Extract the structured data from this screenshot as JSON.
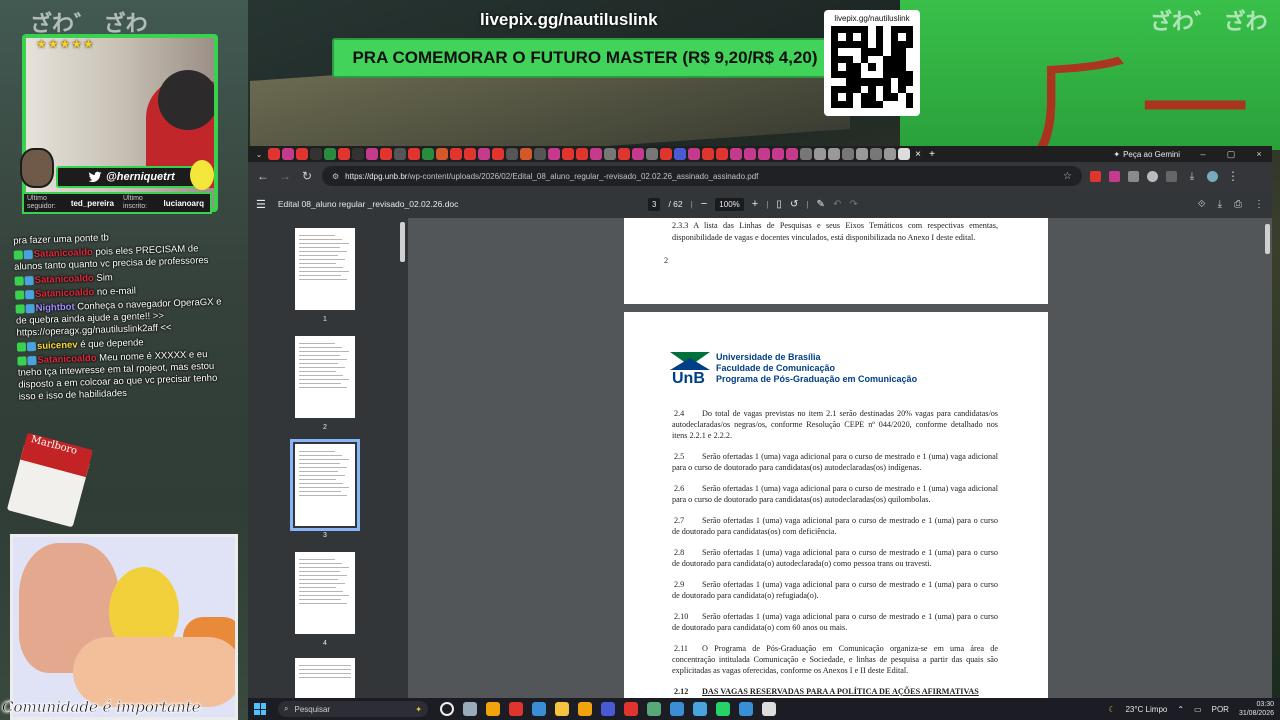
{
  "overlay": {
    "top_url": "livepix.gg/nautiluslink",
    "banner": "PRA COMEMORAR O FUTURO MASTER (R$ 9,20/R$ 4,20)",
    "qr_url": "livepix.gg/nautiluslink",
    "cam_handle": "@herniquetrt",
    "last_follower_label": "Último seguidor:",
    "last_follower": "ted_pereira",
    "last_sub_label": "Último inscrito:",
    "last_sub": "lucianoarq",
    "meme_caption": "Comunidade é importante",
    "marlboro": "Marlboro"
  },
  "chat": [
    {
      "user": "",
      "text": "pra fazer uma ponte tb"
    },
    {
      "user": "Satanicoaldo",
      "text": "pois eles PRECISAM de alunos tanto quanto vc precisa de professores",
      "cls": "u-red"
    },
    {
      "user": "Satanicoaldo",
      "text": "Sim",
      "cls": "u-red"
    },
    {
      "user": "Satanicoaldo",
      "text": "no e-mail",
      "cls": "u-red"
    },
    {
      "user": "Nightbot",
      "text": "Conheça o navegador OperaGX e de quebra ainda ajude a gente!! >> https://operagx.gg/nautiluslink2aff <<",
      "cls": "u-bot"
    },
    {
      "user": "suicenev",
      "text": "é que depende",
      "cls": "u-yel"
    },
    {
      "user": "Satanicoaldo",
      "text": "Meu nome é XXXXX e eu tneho tça intewresse em tal rpojeot, mas estou disposto a em colcoar ao que vc precisar tenho isso e isso de habilidades",
      "cls": "u-red"
    }
  ],
  "browser": {
    "tab_active": "Peça ao Gemini",
    "url_host": "https://dpg.unb.br",
    "url_path": "/wp-content/uploads/2026/02/Edital_08_aluno_regular_-revisado_02.02.26_assinado_assinado.pdf"
  },
  "pdf": {
    "title": "Edital 08_aluno regular _revisado_02.02.26.doc",
    "page_current": "3",
    "page_total": "/ 62",
    "zoom": "100%",
    "thumbs": [
      "1",
      "2",
      "3",
      "4"
    ],
    "page1_text": "2.3.3        A lista das Linhas de Pesquisas e seus Eixos Temáticos com respectivas ementas, disponibilidade de vagas e docentes vinculados, está disponibilizada no Anexo I deste edital.",
    "page1_number": "2",
    "header": {
      "logo": "UnB",
      "line1": "Universidade de Brasília",
      "line2": "Faculdade de Comunicação",
      "line3": "Programa de Pós-Graduação em Comunicação"
    },
    "items": [
      {
        "num": "2.4",
        "text": "Do total de vagas previstas no item 2.1 serão destinadas 20% vagas para candidatas/os autodeclaradas/os negras/os, conforme Resolução CEPE nº 044/2020, conforme detalhado nos itens 2.2.1 e 2.2.2."
      },
      {
        "num": "2.5",
        "text": "Serão ofertadas 1 (uma) vaga adicional para o curso de mestrado e 1 (uma) vaga adicional para o curso de doutorado para candidatas(os) autodeclaradas(os) indígenas."
      },
      {
        "num": "2.6",
        "text": "Serão ofertadas 1 (uma) vaga adicional para o curso de mestrado e 1 (uma) vaga adicional para o curso de doutorado para candidatas(os) autodeclaradas(os) quilombolas."
      },
      {
        "num": "2.7",
        "text": "Serão ofertadas 1 (uma) vaga adicional para o curso de mestrado e 1 (uma) para o curso de doutorado para candidatas(os) com deficiência."
      },
      {
        "num": "2.8",
        "text": "Serão ofertadas 1 (uma) vaga adicional para o curso de mestrado e 1 (uma) para o curso de doutorado para candidata(o) autodeclarada(o) como pessoa trans ou travesti."
      },
      {
        "num": "2.9",
        "text": "Serão ofertadas 1 (uma) vaga adicional para o curso de mestrado e 1 (uma) para o curso de doutorado para candidata(o) refugiada(o)."
      },
      {
        "num": "2.10",
        "text": "Serão ofertadas 1 (uma) vaga adicional para o curso de mestrado e 1 (uma) para o curso de doutorado para candidata(o) com 60 anos ou mais."
      },
      {
        "num": "2.11",
        "text": "O Programa de Pós-Graduação em Comunicação organiza-se em uma área de concentração intitulada Comunicação e Sociedade, e linhas de pesquisa a partir das quais são explicitadas as vagas oferecidas, conforme os Anexos I e II deste Edital."
      }
    ],
    "heading_num": "2.12",
    "heading": "DAS VAGAS RESERVADAS PARA A POLÍTICA DE AÇÕES AFIRMATIVAS"
  },
  "taskbar": {
    "search_placeholder": "Pesquisar",
    "weather": "23°C  Limpo",
    "lang": "POR",
    "time": "03:30",
    "date": "31/08/2026"
  }
}
